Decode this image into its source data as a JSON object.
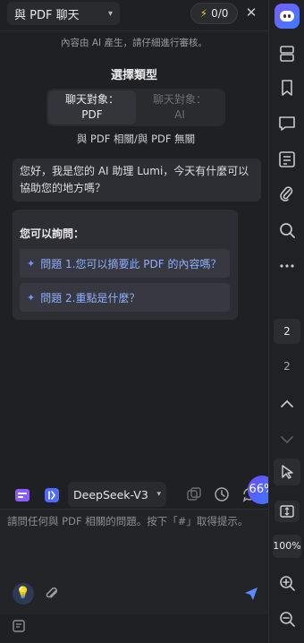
{
  "header": {
    "mode_label": "與 PDF 聊天",
    "credits": "0/0"
  },
  "notice": "內容由 AI 產生，請仔細進行審核。",
  "chooser": {
    "title": "選擇類型",
    "options": [
      {
        "line1": "聊天對象：",
        "line2": "PDF"
      },
      {
        "line1": "聊天對象：",
        "line2": "AI"
      }
    ],
    "description": "與 PDF 相關/與 PDF 無關"
  },
  "greeting": "您好，我是您的 AI 助理 Lumi，今天有什麼可以協助您的地方嗎？",
  "suggestions": {
    "heading": "您可以詢問：",
    "items": [
      "問題 1.您可以摘要此 PDF 的內容嗎？",
      "問題 2.重點是什麼？"
    ]
  },
  "model": {
    "name": "DeepSeek-V3"
  },
  "zoom_badge": "66%",
  "input": {
    "placeholder": "請問任何與 PDF 相關的問題。按下「#」取得提示。"
  },
  "sidebar": {
    "current_page": "2",
    "total_pages": "2",
    "zoom": "100%"
  },
  "colors": {
    "accent": "#5b8cff",
    "suggest_text": "#8fb0ff",
    "bolt": "#f1c232"
  }
}
